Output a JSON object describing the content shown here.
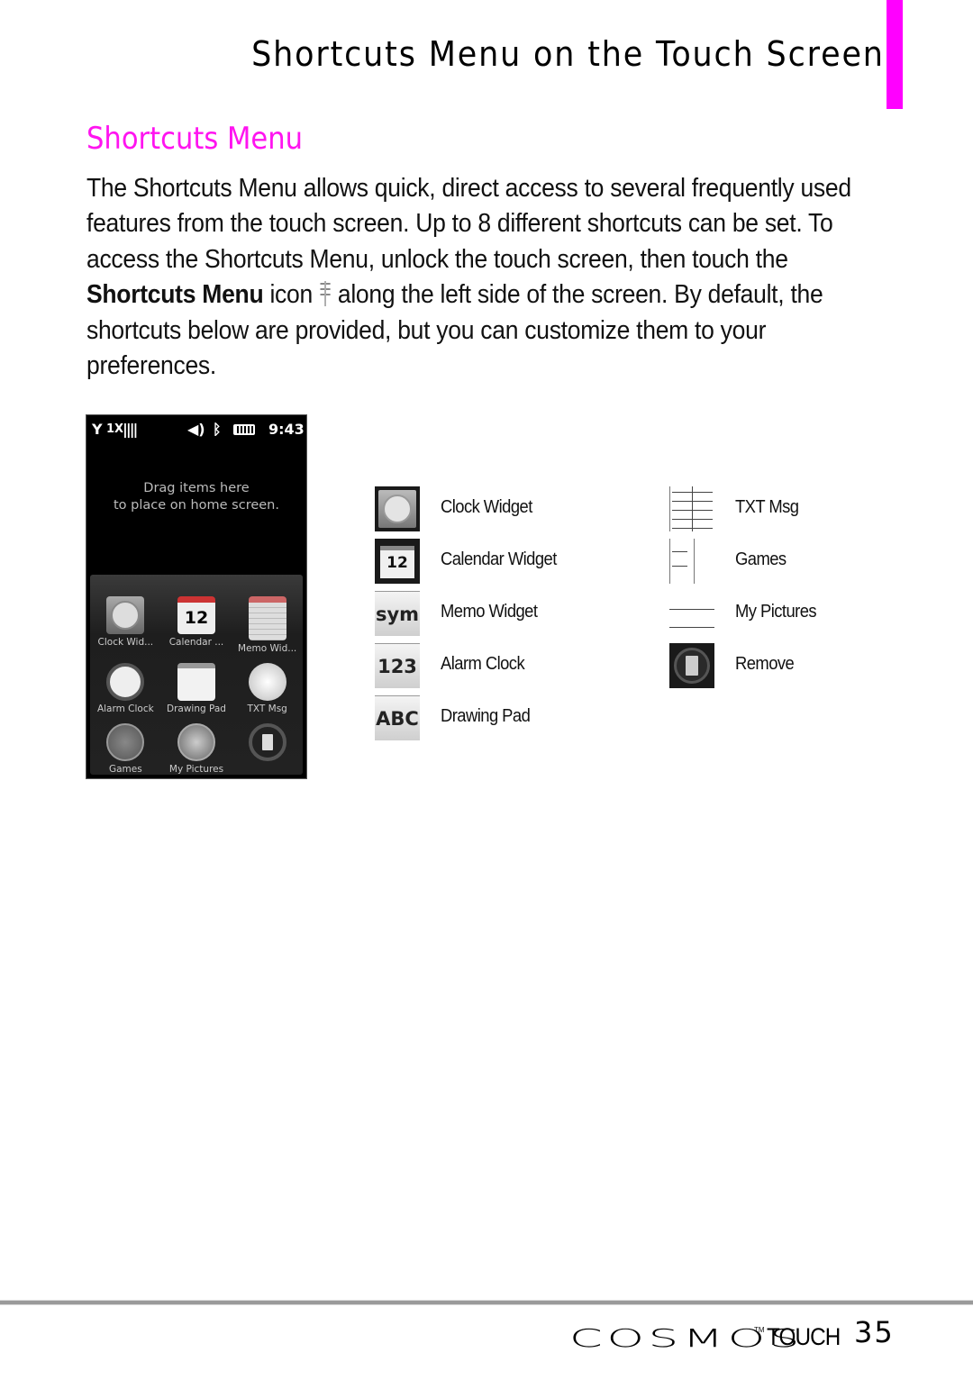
{
  "header": {
    "page_title": "Shortcuts Menu on the Touch Screen",
    "accent_color": "#ff00ff"
  },
  "section": {
    "title": "Shortcuts Menu",
    "title_color": "#ff14f0"
  },
  "body": {
    "line1": "The Shortcuts Menu allows quick, direct access to several frequently used",
    "line2": "features from the touch screen. Up to 8 different shortcuts can be set. To",
    "line3": "access the Shortcuts Menu, unlock the touch screen, then touch the",
    "line4_bold": "Shortcuts Menu",
    "line4_a": " icon",
    "line4_icon": "shortcuts-menu-icon",
    "line4_b": "along the left side of the screen. By default, the",
    "line5": "shortcuts below are provided, but you can customize them to your",
    "line6": "preferences."
  },
  "phone": {
    "status": {
      "signal": "Y",
      "network": "1X",
      "bars": "||||",
      "sound_icon": "speaker-icon",
      "bluetooth_icon": "bluetooth-icon",
      "battery_icon": "battery-icon",
      "time": "9:43"
    },
    "drag_message_line1": "Drag items here",
    "drag_message_line2": "to place on home screen.",
    "tray": [
      {
        "label": "Clock Wid...",
        "icon": "clock-icon"
      },
      {
        "label": "Calendar ...",
        "icon": "calendar-icon",
        "icon_text": "12"
      },
      {
        "label": "Memo Wid...",
        "icon": "memo-icon"
      },
      {
        "label": "Alarm Clock",
        "icon": "alarm-clock-icon"
      },
      {
        "label": "Drawing Pad",
        "icon": "drawing-pad-icon"
      },
      {
        "label": "TXT Msg",
        "icon": "txt-msg-icon"
      },
      {
        "label": "Games",
        "icon": "games-icon"
      },
      {
        "label": "My Pictures",
        "icon": "my-pictures-icon"
      },
      {
        "label": "",
        "icon": "trash-icon"
      }
    ]
  },
  "shortcuts_left": [
    {
      "label": "Clock Widget",
      "icon": "clock-icon"
    },
    {
      "label": "Calendar Widget",
      "icon": "calendar-icon",
      "icon_text": "12"
    },
    {
      "label": "Memo Widget",
      "icon": "sym-key-icon",
      "icon_text": "sym"
    },
    {
      "label": "Alarm Clock",
      "icon": "123-key-icon",
      "icon_text": "123"
    },
    {
      "label": "Drawing Pad",
      "icon": "abc-key-icon",
      "icon_text": "ABC"
    }
  ],
  "shortcuts_right": [
    {
      "label": "TXT Msg",
      "icon": "txt-msg-icon"
    },
    {
      "label": "Games",
      "icon": "games-icon"
    },
    {
      "label": "My Pictures",
      "icon": "my-pictures-icon"
    },
    {
      "label": "Remove",
      "icon": "trash-icon"
    }
  ],
  "footer": {
    "brand": "COSMOS",
    "trademark": "TM",
    "brand_suffix": "TOUCH",
    "page_number": "35"
  }
}
